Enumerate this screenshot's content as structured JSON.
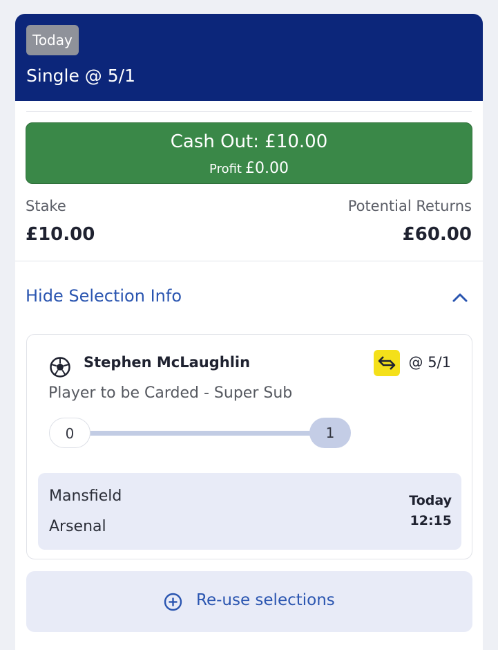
{
  "header": {
    "badge": "Today",
    "bet_type": "Single @ 5/1"
  },
  "cashout": {
    "label": "Cash Out: £10.00",
    "profit_label": "Profit",
    "profit_value": "£0.00"
  },
  "stake": {
    "label": "Stake",
    "value": "£10.00"
  },
  "returns": {
    "label": "Potential Returns",
    "value": "£60.00"
  },
  "selection_toggle": {
    "label": "Hide Selection Info",
    "icon": "chevron-up-icon"
  },
  "selection": {
    "sport_icon": "football-icon",
    "player": "Stephen McLaughlin",
    "swap_icon": "swap-arrows-icon",
    "price": "@ 5/1",
    "market": "Player to be Carded - Super Sub",
    "progress": {
      "start": "0",
      "end": "1",
      "filled": 1.0
    },
    "event": {
      "home": "Mansfield",
      "away": "Arsenal",
      "day": "Today",
      "time": "12:15"
    }
  },
  "reuse": {
    "label": "Re-use selections",
    "icon": "plus-circle-icon"
  },
  "colors": {
    "header_bg": "#0c267a",
    "cashout_green": "#3a8848",
    "link_blue": "#2a55b0",
    "badge_yellow": "#f4e01a",
    "panel_bg": "#e8ebf7"
  }
}
